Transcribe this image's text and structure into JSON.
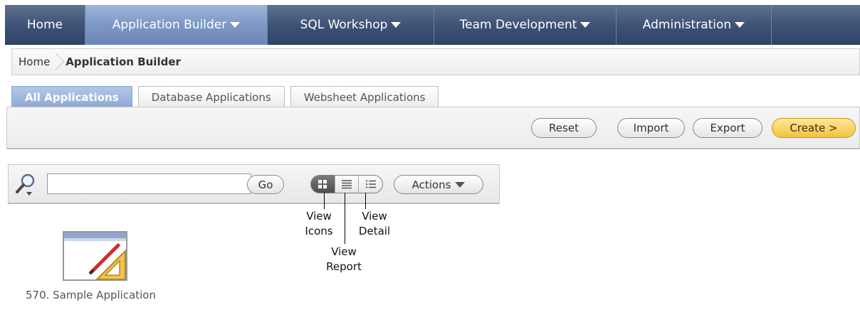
{
  "nav": {
    "tabs": [
      {
        "label": "Home",
        "dropdown": false,
        "active": false
      },
      {
        "label": "Application Builder",
        "dropdown": true,
        "active": true
      },
      {
        "label": "SQL Workshop",
        "dropdown": true,
        "active": false
      },
      {
        "label": "Team Development",
        "dropdown": true,
        "active": false
      },
      {
        "label": "Administration",
        "dropdown": true,
        "active": false
      }
    ]
  },
  "breadcrumb": {
    "items": [
      {
        "label": "Home"
      },
      {
        "label": "Application Builder"
      }
    ]
  },
  "subtabs": [
    {
      "label": "All Applications",
      "active": true
    },
    {
      "label": "Database Applications",
      "active": false
    },
    {
      "label": "Websheet Applications",
      "active": false
    }
  ],
  "buttons": {
    "reset": "Reset",
    "import": "Import",
    "export": "Export",
    "create": "Create >"
  },
  "search": {
    "value": "",
    "go": "Go",
    "actions": "Actions"
  },
  "view_segment": {
    "selected": "icons",
    "options": [
      "icons",
      "report",
      "detail"
    ]
  },
  "callouts": {
    "icons": [
      "View",
      "Icons"
    ],
    "report": [
      "View",
      "Report"
    ],
    "detail": [
      "View",
      "Detail"
    ]
  },
  "applications": [
    {
      "label": "570. Sample Application"
    }
  ],
  "colors": {
    "nav_bg": "#3c5274",
    "nav_active": "#7d98c6",
    "create_button": "#f3c33e"
  }
}
